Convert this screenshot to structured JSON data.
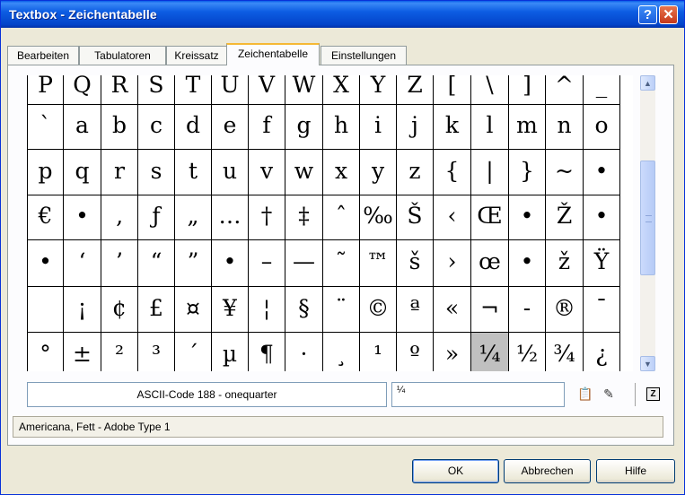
{
  "window": {
    "title": "Textbox - Zeichentabelle",
    "help_glyph": "?",
    "close_glyph": "✕"
  },
  "tabs": [
    {
      "label": "Bearbeiten"
    },
    {
      "label": "Tabulatoren"
    },
    {
      "label": "Kreissatz"
    },
    {
      "label": "Zeichentabelle"
    },
    {
      "label": "Einstellungen"
    }
  ],
  "active_tab": "Zeichentabelle",
  "char_grid": {
    "rows": [
      [
        "P",
        "Q",
        "R",
        "S",
        "T",
        "U",
        "V",
        "W",
        "X",
        "Y",
        "Z",
        "[",
        "\\",
        "]",
        "^",
        "_"
      ],
      [
        "`",
        "a",
        "b",
        "c",
        "d",
        "e",
        "f",
        "g",
        "h",
        "i",
        "j",
        "k",
        "l",
        "m",
        "n",
        "o"
      ],
      [
        "p",
        "q",
        "r",
        "s",
        "t",
        "u",
        "v",
        "w",
        "x",
        "y",
        "z",
        "{",
        "|",
        "}",
        "~",
        "•"
      ],
      [
        "€",
        "•",
        "‚",
        "ƒ",
        "„",
        "…",
        "†",
        "‡",
        "ˆ",
        "‰",
        "Š",
        "‹",
        "Œ",
        "•",
        "Ž",
        "•"
      ],
      [
        "•",
        "‘",
        "’",
        "“",
        "”",
        "•",
        "–",
        "—",
        "˜",
        "™",
        "š",
        "›",
        "œ",
        "•",
        "ž",
        "Ÿ"
      ],
      [
        " ",
        "¡",
        "¢",
        "£",
        "¤",
        "¥",
        "¦",
        "§",
        "¨",
        "©",
        "ª",
        "«",
        "¬",
        "-",
        "®",
        "¯"
      ],
      [
        "°",
        "±",
        "²",
        "³",
        "´",
        "µ",
        "¶",
        "·",
        "¸",
        "¹",
        "º",
        "»",
        "¼",
        "½",
        "¾",
        "¿"
      ]
    ],
    "selected": "¼"
  },
  "scrollbar": {
    "up_glyph": "▲",
    "down_glyph": "▼"
  },
  "ascii_field": "ASCII-Code 188  -  onequarter",
  "char_field": "¼",
  "tool_icons": {
    "paste_icon": "📋",
    "eraser_icon": "✎",
    "z_icon": "Z"
  },
  "status": "Americana, Fett  -  Adobe Type 1",
  "buttons": {
    "ok": "OK",
    "cancel": "Abbrechen",
    "help": "Hilfe"
  }
}
